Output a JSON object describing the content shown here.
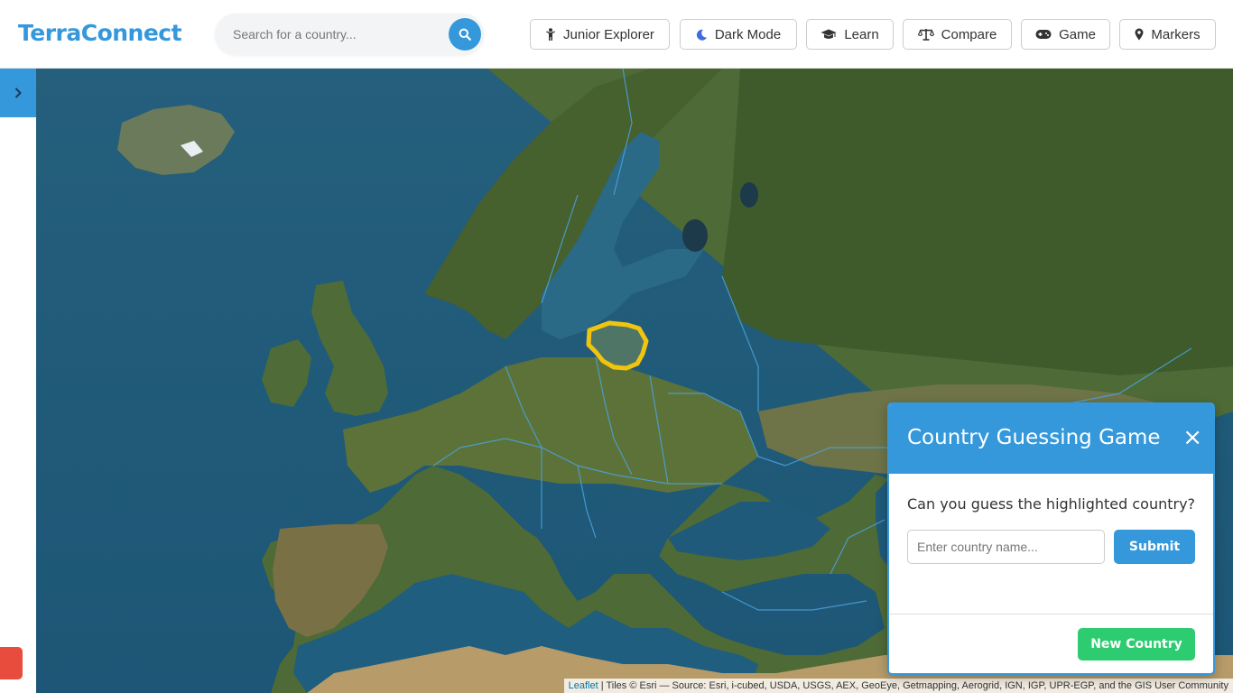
{
  "app": {
    "title": "TerraConnect",
    "accent_color": "#3498db"
  },
  "search": {
    "placeholder": "Search for a country...",
    "value": "",
    "button_icon": "search-icon"
  },
  "nav": {
    "junior_explorer": {
      "label": "Junior Explorer",
      "icon": "child-icon"
    },
    "dark_mode": {
      "label": "Dark Mode",
      "icon": "moon-icon"
    },
    "learn": {
      "label": "Learn",
      "icon": "graduation-cap-icon"
    },
    "compare": {
      "label": "Compare",
      "icon": "balance-scale-icon"
    },
    "game": {
      "label": "Game",
      "icon": "gamepad-icon"
    },
    "markers": {
      "label": "Markers",
      "icon": "map-marker-icon"
    }
  },
  "sidebar": {
    "toggle_icon": "chevron-right-icon"
  },
  "map": {
    "highlight_color": "#f1c40f",
    "attribution": {
      "leaflet": "Leaflet",
      "rest": " | Tiles © Esri — Source: Esri, i-cubed, USDA, USGS, AEX, GeoEye, Getmapping, Aerogrid, IGN, IGP, UPR-EGP, and the GIS User Community"
    }
  },
  "game": {
    "title": "Country Guessing Game",
    "close": "×",
    "question": "Can you guess the highlighted country?",
    "input_placeholder": "Enter country name...",
    "input_value": "",
    "submit_label": "Submit",
    "new_country_label": "New Country",
    "new_country_color": "#2ecc71"
  }
}
